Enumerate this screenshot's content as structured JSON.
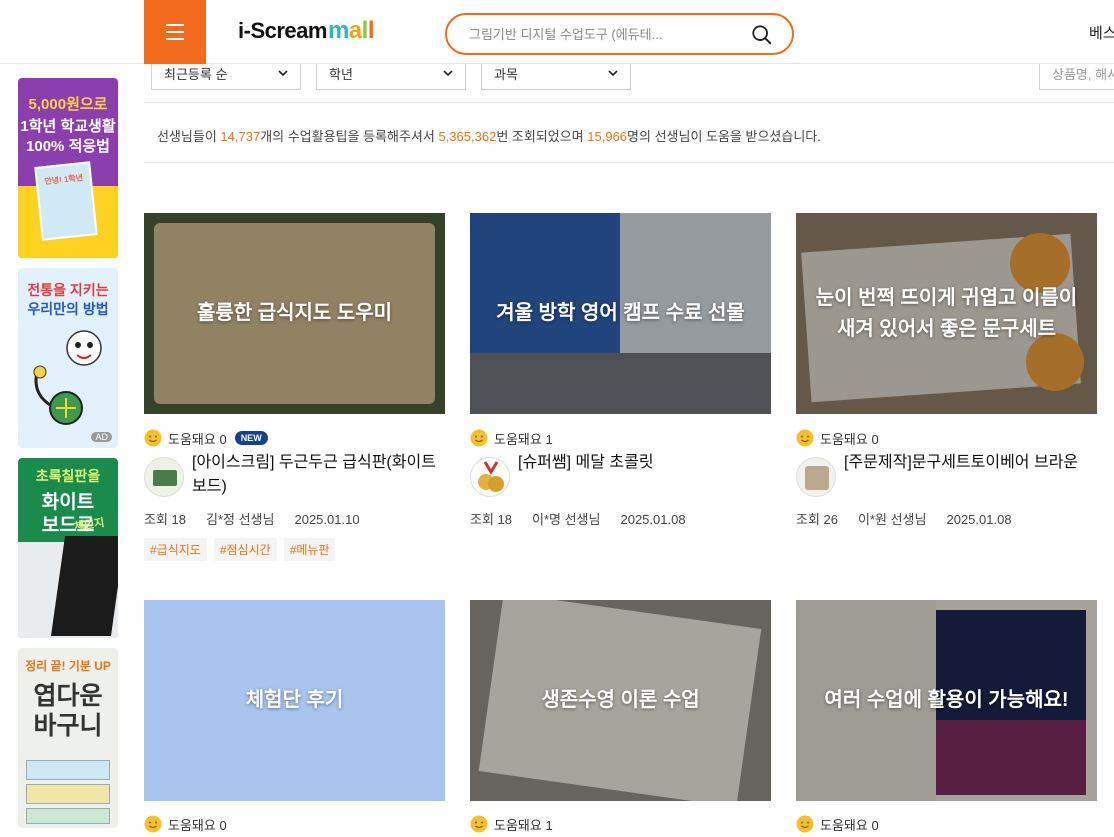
{
  "header": {
    "logo_text": "i-Scream",
    "logo_mall": {
      "m": "m",
      "a": "a",
      "l1": "l",
      "l2": "l"
    },
    "search_placeholder": "그림기반 디지털 수업도구 (에듀테...",
    "right_link": "베스"
  },
  "banners": [
    {
      "lines": [
        "5,000원으로",
        "1학년 학교생활",
        "100% 적응법"
      ],
      "sub": "안녕! 1학년"
    },
    {
      "lines": [
        "전통을 지키는",
        "우리만의 방법"
      ],
      "ad": "AD"
    },
    {
      "lines": [
        "초록칠판을",
        "화이트",
        "보드로"
      ],
      "sub": "체인지"
    },
    {
      "lines": [
        "정리 끝! 기분 UP",
        "엽다운",
        "바구니"
      ]
    }
  ],
  "filters": {
    "sort": "최근등록 순",
    "grade": "학년",
    "subject": "과목",
    "keyword_placeholder": "상품명, 해시"
  },
  "stats": {
    "prefix": "선생님들이 ",
    "tips": "14,737",
    "mid1": "개의 수업활용팁을 등록해주셔서 ",
    "views": "5,365,362",
    "mid2": "번 조회되었으며 ",
    "teachers": "15,966",
    "suffix": "명의 선생님이 도움을 받으셨습니다."
  },
  "cards": [
    {
      "thumb_title": "훌륭한 급식지도 도우미",
      "help": "도움돼요 0",
      "badge": "NEW",
      "title": "[아이스크림] 두근두근 급식판(화이트보드)",
      "views": "조회 18",
      "author": "김*정 선생님",
      "date": "2025.01.10",
      "tags": [
        "#급식지도",
        "#점심시간",
        "#메뉴판"
      ],
      "thumb_color": "#4c5a3a"
    },
    {
      "thumb_title": "겨울 방학 영어 캠프 수료 선물",
      "help": "도움돼요 1",
      "badge": "",
      "title": "[슈퍼쌤] 메달 초콜릿",
      "views": "조회 18",
      "author": "이*명 선생님",
      "date": "2025.01.08",
      "tags": [],
      "thumb_color": "#4a6d9c"
    },
    {
      "thumb_title": "눈이 번쩍 뜨이게 귀엽고 이름이 새겨 있어서 좋은 문구세트",
      "help": "도움돼요 0",
      "badge": "",
      "title": "[주문제작]문구세트토이베어 브라운",
      "views": "조회 26",
      "author": "이*원 선생님",
      "date": "2025.01.08",
      "tags": [],
      "thumb_color": "#8a7a66"
    },
    {
      "thumb_title": "체험단 후기",
      "help": "도움돼요 0",
      "badge": "",
      "thumb_color": "#a9c4ee"
    },
    {
      "thumb_title": "생존수영 이론 수업",
      "help": "도움돼요 1",
      "badge": "",
      "thumb_color": "#8f8a84"
    },
    {
      "thumb_title": "여러 수업에 활용이 가능해요!",
      "help": "도움돼요 0",
      "badge": "",
      "thumb_color": "#55506a"
    }
  ],
  "colors": {
    "accent": "#f26b1d",
    "highlight": "#e8750f",
    "badge": "#153f8f"
  }
}
